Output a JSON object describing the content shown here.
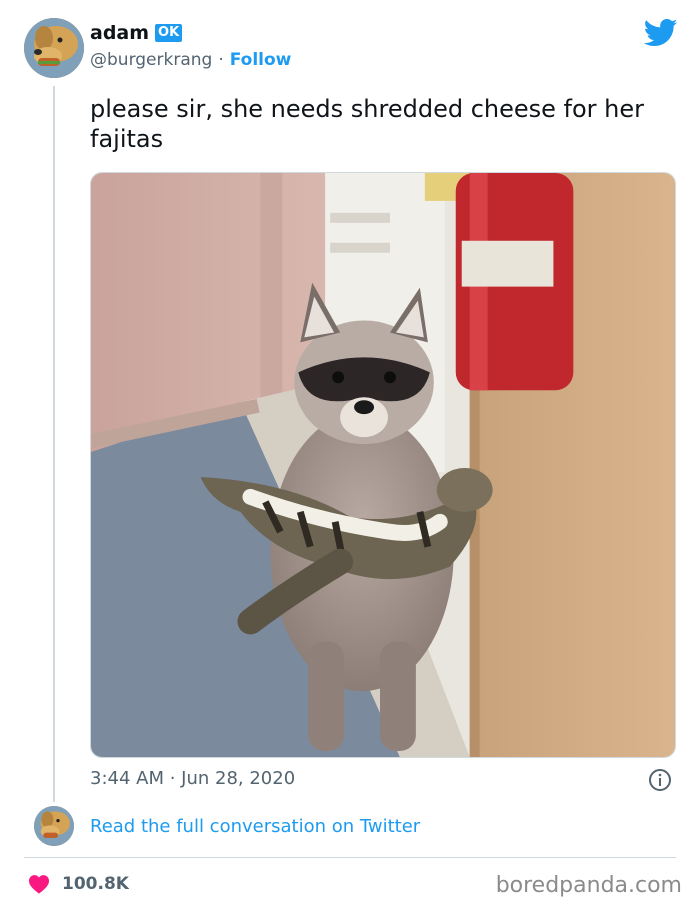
{
  "author": {
    "display_name": "adam",
    "badge": "OK",
    "handle": "@burgerkrang",
    "separator": "·",
    "follow_label": "Follow"
  },
  "tweet": {
    "text": "please sir, she needs shredded cheese for her fajitas",
    "timestamp": "3:44 AM · Jun 28, 2020"
  },
  "footer": {
    "read_conversation": "Read the full conversation on Twitter",
    "like_count": "100.8K"
  },
  "watermark": "boredpanda.com",
  "icons": {
    "brand": "twitter-bird-icon",
    "info": "info-icon",
    "like": "heart-icon"
  },
  "colors": {
    "accent": "#1d9bf0",
    "heart": "#f91880",
    "secondary_text": "#536471"
  }
}
